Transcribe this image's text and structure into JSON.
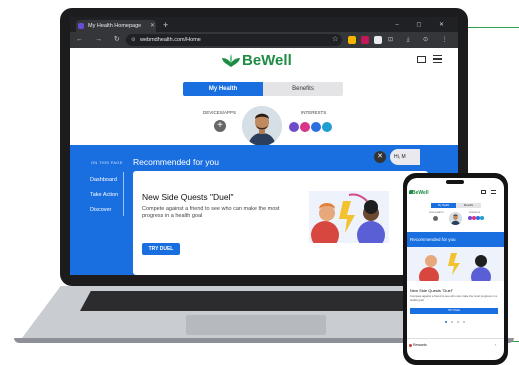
{
  "browser": {
    "tab_title": "My Health Homepage",
    "new_tab": "+",
    "window_controls": "– ◻ ✕",
    "nav_icons": "← → ↻ ⌂",
    "url": "webmdhealth.com/Home",
    "star": "☆",
    "toolbar_icons": "⊡ ⤓ ⊙ ⋮"
  },
  "site": {
    "brand": "BeWell",
    "tabs": [
      "My Health",
      "Benefits"
    ],
    "devices_label": "DEVICES/APPS",
    "interests_label": "INTERESTS",
    "add_device": "+",
    "on_this_page": "ON THIS PAGE",
    "sidebar_items": [
      "Dashboard",
      "Take Action",
      "Discover"
    ],
    "recommended_title": "Recommended for you",
    "card_title": "New Side Quests \"Duel\"",
    "card_body": "Compete against a friend to see who can make the most progress in a health goal",
    "card_button": "TRY DUEL",
    "close": "✕",
    "chat_greeting": "Hi, M"
  },
  "phone": {
    "brand": "BeWell",
    "tabs": [
      "My Health",
      "Benefits"
    ],
    "devices_label": "DEVICES/APPS",
    "interests_label": "INTERESTS",
    "recommended_title": "Recommended for you",
    "card_title": "New Side Quests \"Duel\"",
    "card_body": "Compete against a friend to see who can make the most progress in a health goal",
    "card_button": "TRY DUEL",
    "rewards_label": "Rewards",
    "caret": "›"
  },
  "colors": {
    "brand_green": "#1e8c45",
    "accent_blue": "#1a6fe0",
    "interest_icons": [
      "#6d4cc9",
      "#d9338a",
      "#2b6fe0",
      "#1f9ecf"
    ]
  }
}
